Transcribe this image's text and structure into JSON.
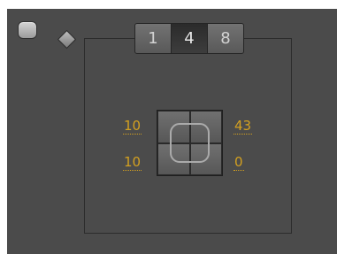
{
  "tabs": [
    {
      "label": "1",
      "selected": false
    },
    {
      "label": "4",
      "selected": true
    },
    {
      "label": "8",
      "selected": false
    }
  ],
  "values": {
    "top_left": "10",
    "top_right": "43",
    "bottom_left": "10",
    "bottom_right": "0"
  },
  "colors": {
    "panel_bg": "#4b4b4b",
    "value_text": "#d3a020"
  },
  "icons": {
    "corner": "rounded-square-icon",
    "diamond": "diamond-icon"
  }
}
